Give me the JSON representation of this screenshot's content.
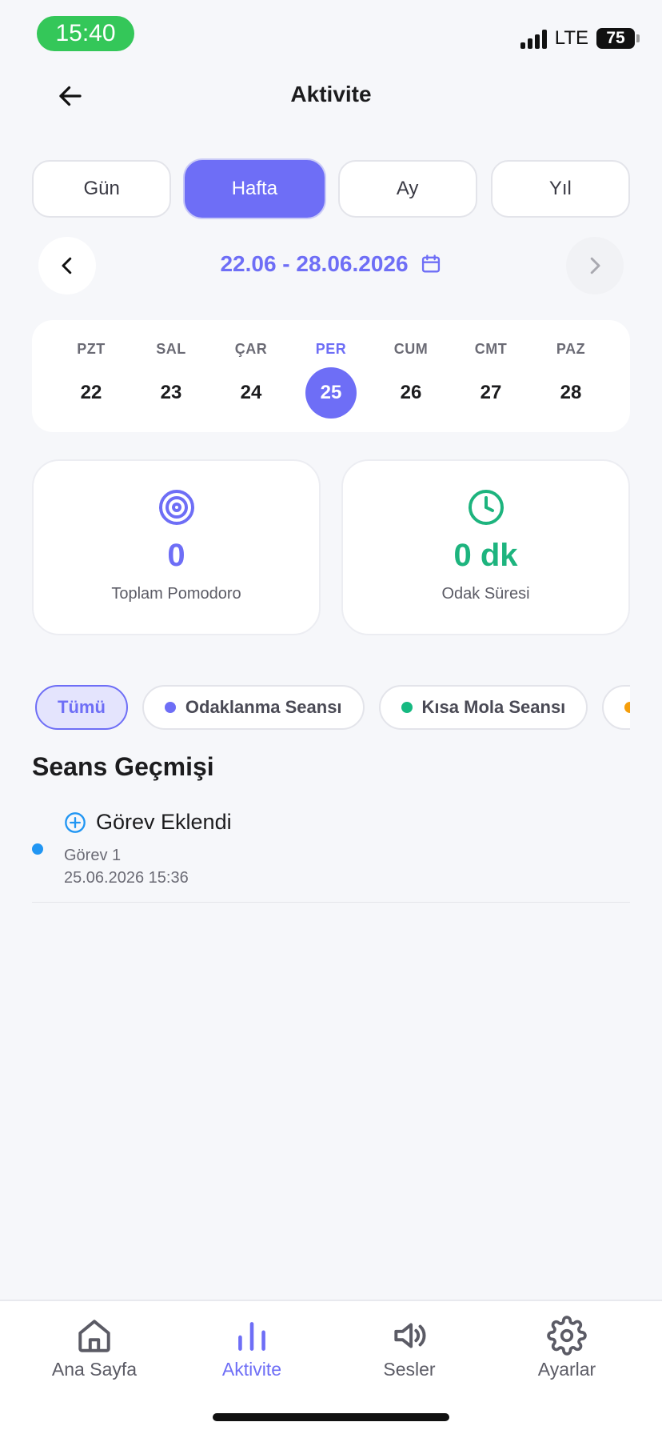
{
  "status_bar": {
    "time": "15:40",
    "network": "LTE",
    "battery": "75"
  },
  "header": {
    "title": "Aktivite"
  },
  "period_tabs": [
    {
      "label": "Gün",
      "active": false
    },
    {
      "label": "Hafta",
      "active": true
    },
    {
      "label": "Ay",
      "active": false
    },
    {
      "label": "Yıl",
      "active": false
    }
  ],
  "date_nav": {
    "range": "22.06 - 28.06.2026"
  },
  "week": [
    {
      "name": "PZT",
      "num": "22"
    },
    {
      "name": "SAL",
      "num": "23"
    },
    {
      "name": "ÇAR",
      "num": "24"
    },
    {
      "name": "PER",
      "num": "25",
      "active": true
    },
    {
      "name": "CUM",
      "num": "26"
    },
    {
      "name": "CMT",
      "num": "27"
    },
    {
      "name": "PAZ",
      "num": "28"
    }
  ],
  "stats": {
    "pomodoro": {
      "value": "0",
      "label": "Toplam Pomodoro",
      "color": "#6E6EF6"
    },
    "focus": {
      "value": "0 dk",
      "label": "Odak Süresi",
      "color": "#1DB47E"
    }
  },
  "filters": [
    {
      "label": "Tümü",
      "active": true,
      "color": ""
    },
    {
      "label": "Odaklanma Seansı",
      "color": "#6E6EF6"
    },
    {
      "label": "Kısa Mola Seansı",
      "color": "#16B981"
    },
    {
      "label": "",
      "color": "#F59E0B"
    }
  ],
  "history": {
    "title": "Seans Geçmişi",
    "items": [
      {
        "title": "Görev Eklendi",
        "task": "Görev 1",
        "time": "25.06.2026 15:36",
        "color": "#2196F3"
      }
    ]
  },
  "bottom_nav": [
    {
      "label": "Ana Sayfa",
      "icon": "home-icon"
    },
    {
      "label": "Aktivite",
      "icon": "chart-icon",
      "active": true
    },
    {
      "label": "Sesler",
      "icon": "speaker-icon"
    },
    {
      "label": "Ayarlar",
      "icon": "gear-icon"
    }
  ],
  "colors": {
    "accent": "#6E6EF6",
    "green": "#1DB47E",
    "background": "#F6F7FA"
  }
}
